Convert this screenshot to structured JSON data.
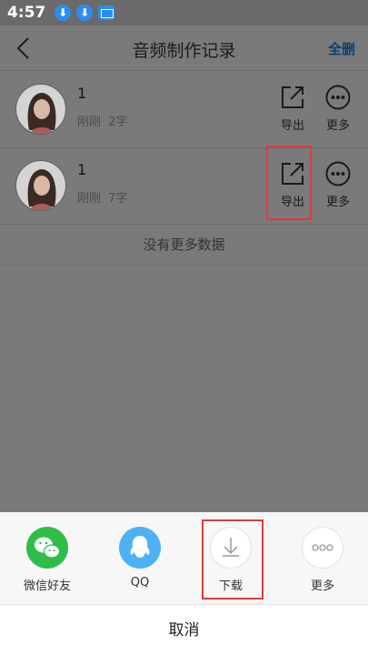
{
  "status": {
    "time": "4:57",
    "download_glyph": "⬇"
  },
  "nav": {
    "title": "音频制作记录",
    "right_action": "全删"
  },
  "records": [
    {
      "title": "1",
      "time": "刚刚",
      "chars": "2字",
      "export_label": "导出",
      "more_label": "更多"
    },
    {
      "title": "1",
      "time": "刚刚",
      "chars": "7字",
      "export_label": "导出",
      "more_label": "更多"
    }
  ],
  "list_footer": "没有更多数据",
  "share": {
    "items": [
      {
        "label": "微信好友",
        "icon": "wechat-icon",
        "color": "#2fbd4a"
      },
      {
        "label": "QQ",
        "icon": "qq-icon",
        "color": "#4db1f4"
      },
      {
        "label": "下载",
        "icon": "download-icon",
        "color": "#ffffff"
      },
      {
        "label": "更多",
        "icon": "more-dots-icon",
        "color": "#ffffff"
      }
    ],
    "cancel": "取消"
  },
  "colors": {
    "overlay": "#7a7a7a",
    "highlight": "#e03b3b",
    "nav_action": "#0c3f6d"
  }
}
